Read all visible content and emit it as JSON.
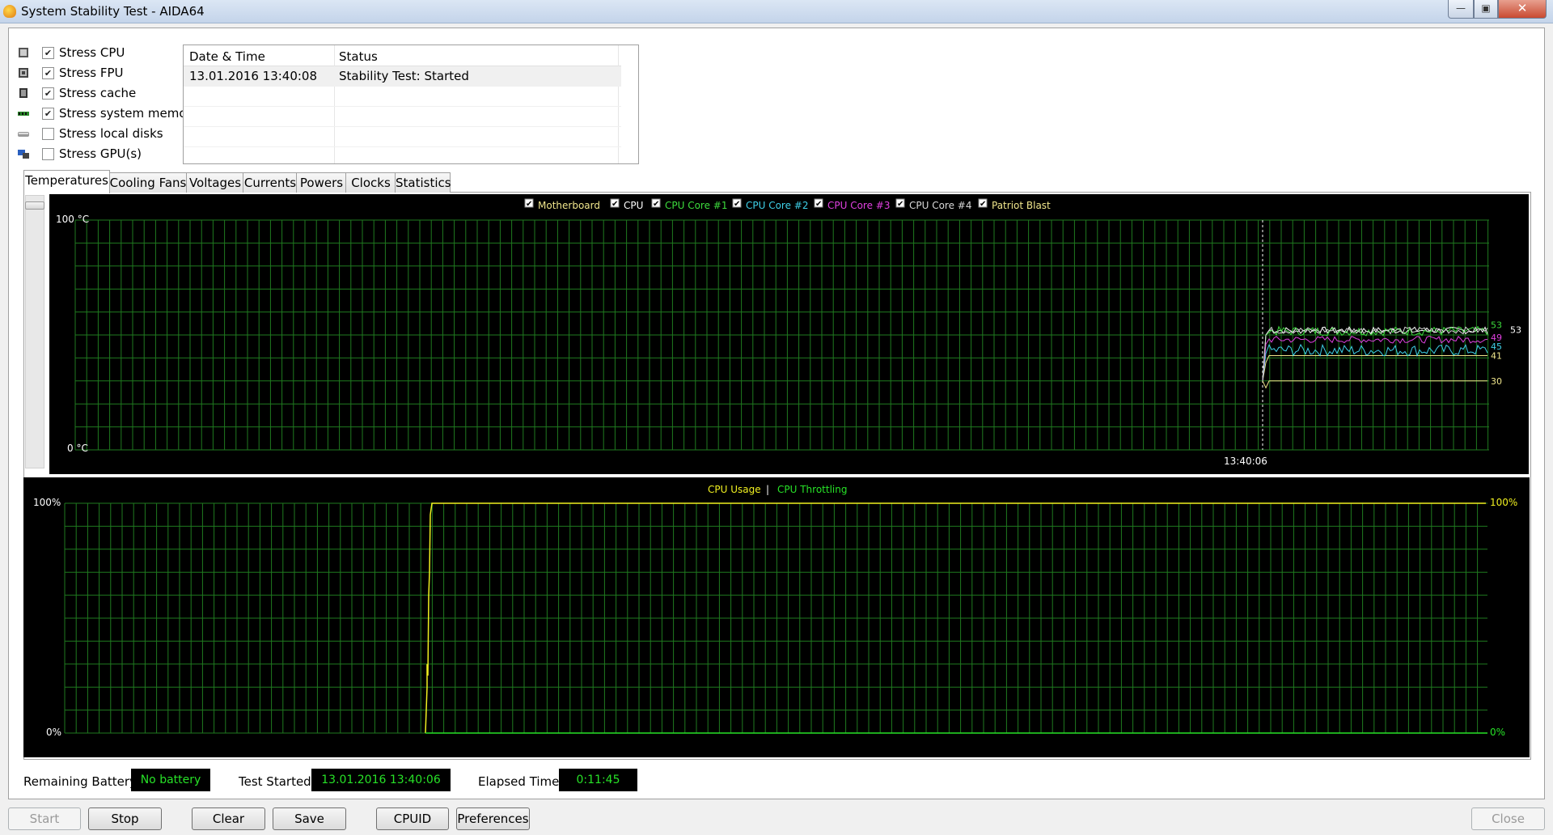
{
  "window": {
    "title": "System Stability Test - AIDA64",
    "min_glyph": "—",
    "max_glyph": "▣",
    "close_glyph": "✕"
  },
  "stress_options": [
    {
      "label": "Stress CPU",
      "checked": true,
      "icon": "cpu-icon"
    },
    {
      "label": "Stress FPU",
      "checked": true,
      "icon": "fpu-icon"
    },
    {
      "label": "Stress cache",
      "checked": true,
      "icon": "cache-icon"
    },
    {
      "label": "Stress system memory",
      "checked": true,
      "icon": "memory-icon"
    },
    {
      "label": "Stress local disks",
      "checked": false,
      "icon": "disk-icon"
    },
    {
      "label": "Stress GPU(s)",
      "checked": false,
      "icon": "gpu-icon"
    }
  ],
  "log": {
    "headers": [
      "Date & Time",
      "Status"
    ],
    "rows": [
      {
        "datetime": "13.01.2016 13:40:08",
        "status": "Stability Test: Started"
      }
    ]
  },
  "tabs": [
    "Temperatures",
    "Cooling Fans",
    "Voltages",
    "Currents",
    "Powers",
    "Clocks",
    "Statistics"
  ],
  "active_tab": "Temperatures",
  "temp_chart": {
    "y_max_label": "100 °C",
    "y_min_label": "0 °C",
    "time_label": "13:40:06",
    "legend": [
      {
        "name": "Motherboard",
        "color": "#f0e68c"
      },
      {
        "name": "CPU",
        "color": "#ffffff"
      },
      {
        "name": "CPU Core #1",
        "color": "#3ddc3d"
      },
      {
        "name": "CPU Core #2",
        "color": "#3ed0e8"
      },
      {
        "name": "CPU Core #3",
        "color": "#e040e0"
      },
      {
        "name": "CPU Core #4",
        "color": "#d8d8d8"
      },
      {
        "name": "Patriot Blast",
        "color": "#f0e68c"
      }
    ],
    "end_labels": [
      {
        "text": "53",
        "color": "#3ddc3d"
      },
      {
        "text": "53",
        "color": "#ffffff"
      },
      {
        "text": "49",
        "color": "#e040e0"
      },
      {
        "text": "45",
        "color": "#3ed0e8"
      },
      {
        "text": "41",
        "color": "#f0e68c"
      },
      {
        "text": "30",
        "color": "#f0e68c"
      }
    ]
  },
  "chart_data": [
    {
      "type": "line",
      "title": "Temperatures",
      "ylabel": "°C",
      "ylim": [
        0,
        100
      ],
      "x_marker": "13:40:06",
      "grid": true,
      "legend_position": "top",
      "series": [
        {
          "name": "Motherboard",
          "start_value": 30,
          "value": 41
        },
        {
          "name": "CPU",
          "start_value": 30,
          "value": 53
        },
        {
          "name": "CPU Core #1",
          "start_value": 30,
          "value": 53
        },
        {
          "name": "CPU Core #2",
          "start_value": 30,
          "value": 45
        },
        {
          "name": "CPU Core #3",
          "start_value": 30,
          "value": 49
        },
        {
          "name": "CPU Core #4",
          "start_value": 30,
          "value": 53
        },
        {
          "name": "Patriot Blast",
          "start_value": 30,
          "value": 30
        }
      ]
    },
    {
      "type": "line",
      "title": "CPU Usage | CPU Throttling",
      "ylim": [
        0,
        100
      ],
      "grid": true,
      "legend_position": "top",
      "series": [
        {
          "name": "CPU Usage",
          "values": [
            0,
            0,
            100,
            100
          ]
        },
        {
          "name": "CPU Throttling",
          "values": [
            0,
            0,
            0,
            0
          ]
        }
      ]
    }
  ],
  "usage_chart": {
    "legend_usage": "CPU Usage",
    "legend_sep": "|",
    "legend_throttle": "CPU Throttling",
    "left_top": "100%",
    "left_bottom": "0%",
    "right_top": "100%",
    "right_bottom": "0%",
    "usage_color": "#f0f020",
    "throttle_color": "#27e227"
  },
  "info": {
    "battery_label": "Remaining Battery:",
    "battery_value": "No battery",
    "started_label": "Test Started:",
    "started_value": "13.01.2016 13:40:06",
    "elapsed_label": "Elapsed Time:",
    "elapsed_value": "0:11:45"
  },
  "buttons": {
    "start": "Start",
    "stop": "Stop",
    "clear": "Clear",
    "save": "Save",
    "cpuid": "CPUID",
    "preferences": "Preferences",
    "close": "Close"
  },
  "colors": {
    "grid": "#1f7a1f",
    "chart_bg": "#000000",
    "info_text": "#27e227"
  }
}
